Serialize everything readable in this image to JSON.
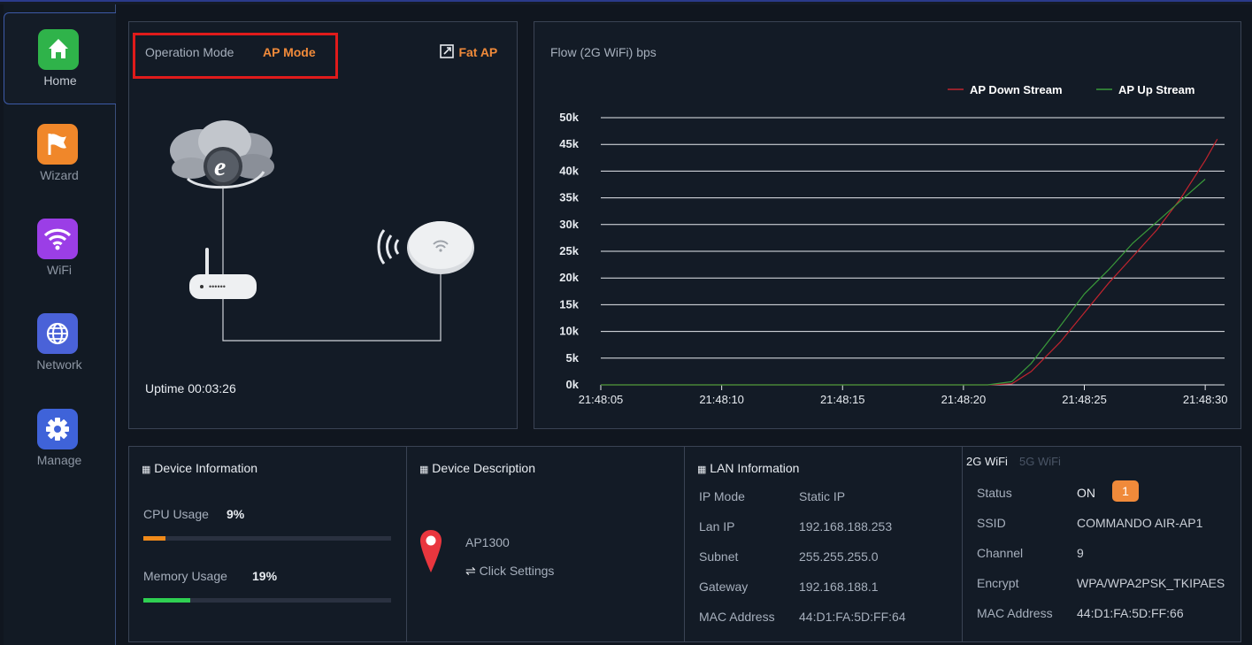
{
  "sidebar": {
    "items": [
      {
        "label": "Home",
        "icon": "home-icon",
        "color": "#2fb34a",
        "active": true
      },
      {
        "label": "Wizard",
        "icon": "flag-icon",
        "color": "#f0872a",
        "active": false
      },
      {
        "label": "WiFi",
        "icon": "wifi-icon",
        "color": "#9b3ee6",
        "active": false
      },
      {
        "label": "Network",
        "icon": "globe-icon",
        "color": "#4a62d8",
        "active": false
      },
      {
        "label": "Manage",
        "icon": "gear-icon",
        "color": "#3f63d9",
        "active": false
      }
    ]
  },
  "mode": {
    "label": "Operation Mode",
    "value": "AP Mode",
    "fat_ap": "Fat AP",
    "uptime_label": "Uptime",
    "uptime_value": "00:03:26"
  },
  "flow": {
    "title": "Flow (2G WiFi) bps"
  },
  "chart_data": {
    "type": "line",
    "x": [
      "21:48:05",
      "21:48:10",
      "21:48:15",
      "21:48:20",
      "21:48:25",
      "21:48:30"
    ],
    "ylim": [
      0,
      50000
    ],
    "yticks": [
      "0k",
      "5k",
      "10k",
      "15k",
      "20k",
      "25k",
      "30k",
      "35k",
      "40k",
      "45k",
      "50k"
    ],
    "legend_position": "top-right",
    "series": [
      {
        "name": "AP Down Stream",
        "color": "#c0242e",
        "points": [
          [
            0,
            0
          ],
          [
            5,
            0
          ],
          [
            10,
            0
          ],
          [
            15,
            0
          ],
          [
            16,
            0
          ],
          [
            17,
            200
          ],
          [
            17.8,
            2500
          ],
          [
            19,
            8000
          ],
          [
            20,
            13500
          ],
          [
            21,
            19000
          ],
          [
            22,
            24000
          ],
          [
            23,
            29000
          ],
          [
            24,
            35000
          ],
          [
            25,
            42000
          ],
          [
            25.5,
            46000
          ]
        ]
      },
      {
        "name": "AP Up Stream",
        "color": "#3a9a3a",
        "points": [
          [
            0,
            0
          ],
          [
            5,
            0
          ],
          [
            10,
            0
          ],
          [
            15,
            0
          ],
          [
            16,
            0
          ],
          [
            17,
            600
          ],
          [
            17.8,
            4000
          ],
          [
            19,
            11000
          ],
          [
            20,
            17000
          ],
          [
            21,
            21500
          ],
          [
            22,
            26500
          ],
          [
            23,
            30500
          ],
          [
            24,
            34500
          ],
          [
            25,
            38500
          ]
        ]
      }
    ]
  },
  "device_info": {
    "title": "Device Information",
    "cpu_label": "CPU Usage",
    "cpu_value": "9%",
    "cpu_fraction": 0.09,
    "cpu_color": "#f08a1a",
    "mem_label": "Memory Usage",
    "mem_value": "19%",
    "mem_fraction": 0.19,
    "mem_color": "#2fd052"
  },
  "device_desc": {
    "title": "Device Description",
    "model": "AP1300",
    "settings": "Click Settings"
  },
  "lan": {
    "title": "LAN Information",
    "rows": [
      {
        "k": "IP Mode",
        "v": "Static IP"
      },
      {
        "k": "Lan IP",
        "v": "192.168.188.253"
      },
      {
        "k": "Subnet",
        "v": "255.255.255.0"
      },
      {
        "k": "Gateway",
        "v": "192.168.188.1"
      },
      {
        "k": "MAC Address",
        "v": "44:D1:FA:5D:FF:64"
      }
    ]
  },
  "wifi": {
    "tabs": [
      {
        "label": "2G WiFi",
        "active": true
      },
      {
        "label": "5G WiFi",
        "active": false
      }
    ],
    "status_label": "Status",
    "status_value": "ON",
    "status_badge": "1",
    "rows": [
      {
        "k": "SSID",
        "v": "COMMANDO AIR-AP1"
      },
      {
        "k": "Channel",
        "v": "9"
      },
      {
        "k": "Encrypt",
        "v": "WPA/WPA2PSK_TKIPAES"
      },
      {
        "k": "MAC Address",
        "v": "44:D1:FA:5D:FF:66"
      }
    ]
  }
}
